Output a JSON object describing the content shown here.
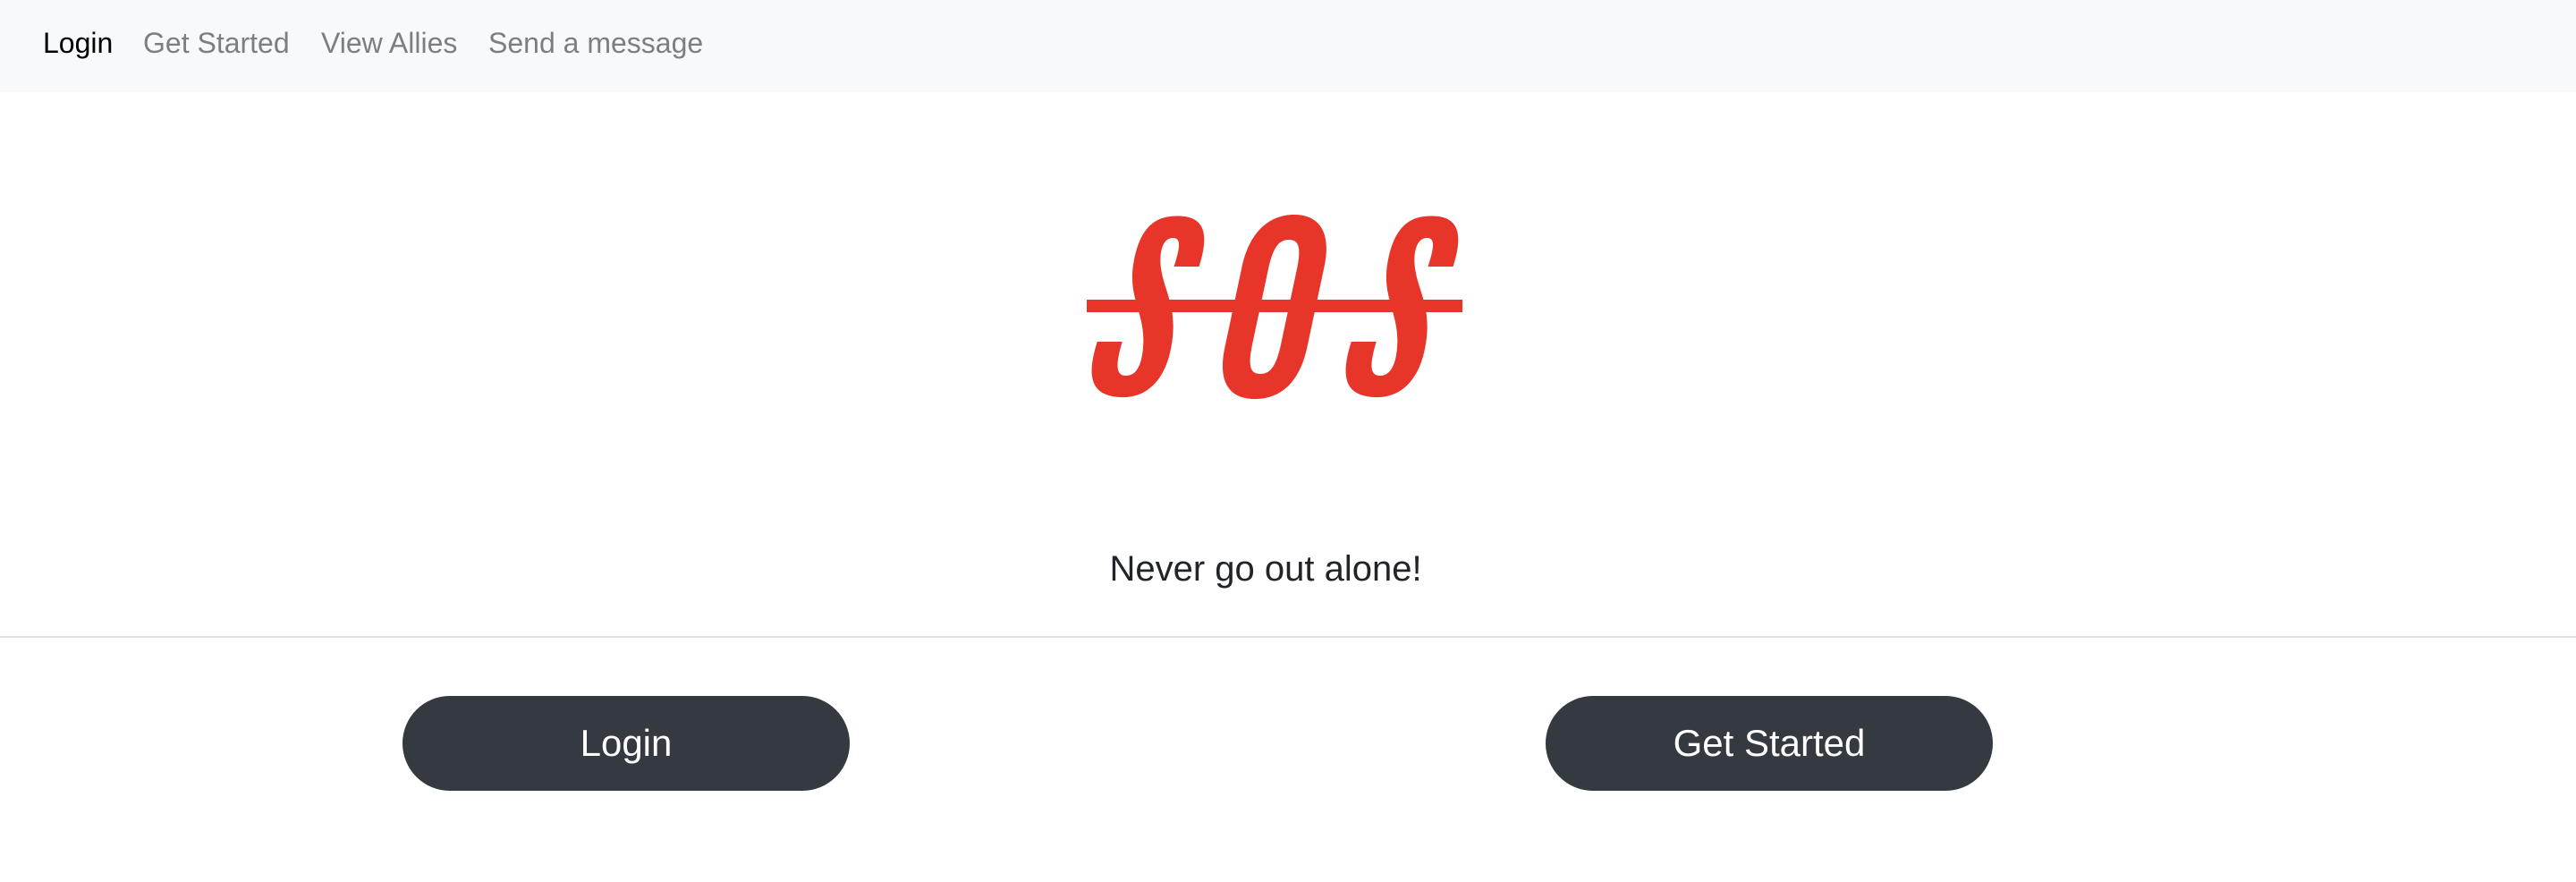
{
  "navbar": {
    "items": [
      {
        "label": "Login",
        "active": true
      },
      {
        "label": "Get Started",
        "active": false
      },
      {
        "label": "View Allies",
        "active": false
      },
      {
        "label": "Send a message",
        "active": false
      }
    ]
  },
  "logo": {
    "text": "SOS",
    "color": "#e8352a"
  },
  "main": {
    "tagline": "Never go out alone!",
    "login_label": "Login",
    "get_started_label": "Get Started"
  },
  "colors": {
    "navbar_bg": "#f8f9fa",
    "button_bg": "#343a40",
    "nav_muted": "#7b7f83"
  }
}
